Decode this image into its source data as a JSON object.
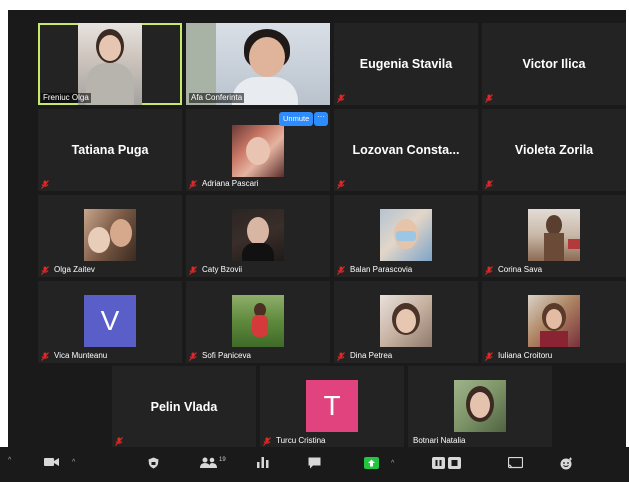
{
  "participants": {
    "freniuc": {
      "label": "Freniuc Olga",
      "muted": false
    },
    "afa": {
      "label": "Afa Conferinta",
      "muted": false
    },
    "eugenia": {
      "name": "Eugenia Stavila",
      "muted": true
    },
    "victor": {
      "name": "Victor Ilica",
      "muted": true
    },
    "tatiana": {
      "name": "Tatiana Puga",
      "muted": true
    },
    "adriana": {
      "label": "Adriana Pascari",
      "muted": true
    },
    "lozovan": {
      "name": "Lozovan Consta...",
      "muted": true
    },
    "violeta": {
      "name": "Violeta Zorila",
      "muted": true
    },
    "olga_zaitev": {
      "label": "Olga Zaitev",
      "muted": true
    },
    "caty": {
      "label": "Caty Bzovii",
      "muted": true
    },
    "balan": {
      "label": "Balan Parascovia",
      "muted": true
    },
    "corina": {
      "label": "Corina Sava",
      "muted": true
    },
    "vica": {
      "label": "Vica Munteanu",
      "avatar_letter": "V",
      "muted": true
    },
    "sofi": {
      "label": "Sofi Paniceva",
      "muted": true
    },
    "dina": {
      "label": "Dina Petrea",
      "muted": true
    },
    "iuliana": {
      "label": "Iuliana Croitoru",
      "muted": true
    },
    "pelin": {
      "name": "Pelin Vlada",
      "muted": true
    },
    "turcu": {
      "label": "Turcu Cristina",
      "avatar_letter": "T",
      "muted": true
    },
    "botnari": {
      "label": "Botnari Natalia",
      "muted": false
    }
  },
  "hover_controls": {
    "unmute_label": "Unmute",
    "more_label": "···"
  },
  "toolbar": {
    "participants_count": "19",
    "icons": [
      "chevron-up-icon",
      "video-icon",
      "chevron-up-icon",
      "security-shield-icon",
      "participants-icon",
      "polls-icon",
      "chat-icon",
      "share-screen-icon",
      "chevron-up-icon",
      "record-icon",
      "stop-icon",
      "cast-icon",
      "reactions-icon"
    ]
  },
  "colors": {
    "active_speaker_border": "#c6e96a",
    "muted_icon": "#e02828",
    "share_green": "#23c43e",
    "button_blue": "#2d8cff",
    "avatar_v": "#5a5ec9",
    "avatar_t": "#e0437d"
  }
}
